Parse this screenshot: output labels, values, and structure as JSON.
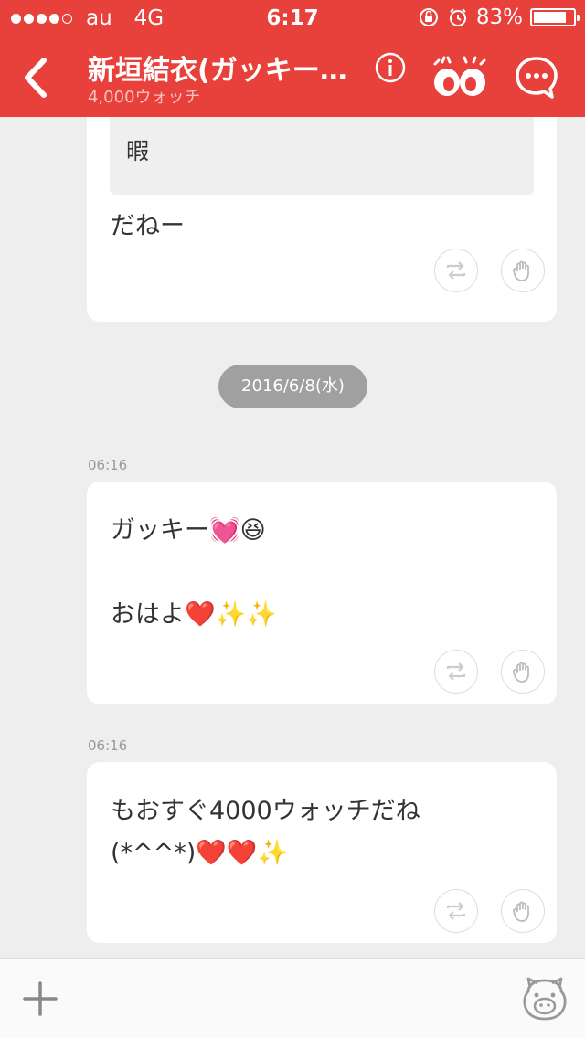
{
  "status_bar": {
    "carrier": "au",
    "network": "4G",
    "time": "6:17",
    "battery_percent_label": "83%",
    "battery_level": 0.83,
    "signal_bars_filled": 4,
    "signal_bars_total": 5
  },
  "header": {
    "title": "新垣結衣(ガッキー…",
    "subtitle": "4,000ウォッチ",
    "background_color": "#e8403a",
    "icons": [
      "back-chevron-icon",
      "info-icon",
      "watch-eyes-icon",
      "chat-bubble-icon"
    ]
  },
  "feed": {
    "previous_card": {
      "quote_text": "暇",
      "text": "だねー"
    },
    "date_divider": "2016/6/8(水)",
    "posts": [
      {
        "time": "06:16",
        "lines": "ガッキー💓😆\n\nおはよ❤️✨✨"
      },
      {
        "time": "06:16",
        "lines": "もおすぐ4000ウォッチだね\n(*^^*)❤️❤️✨"
      }
    ],
    "action_icons": [
      "repost-icon",
      "clap-hand-icon"
    ]
  },
  "bottom_bar": {
    "icons": [
      "plus-icon",
      "stamp-bear-icon"
    ]
  }
}
